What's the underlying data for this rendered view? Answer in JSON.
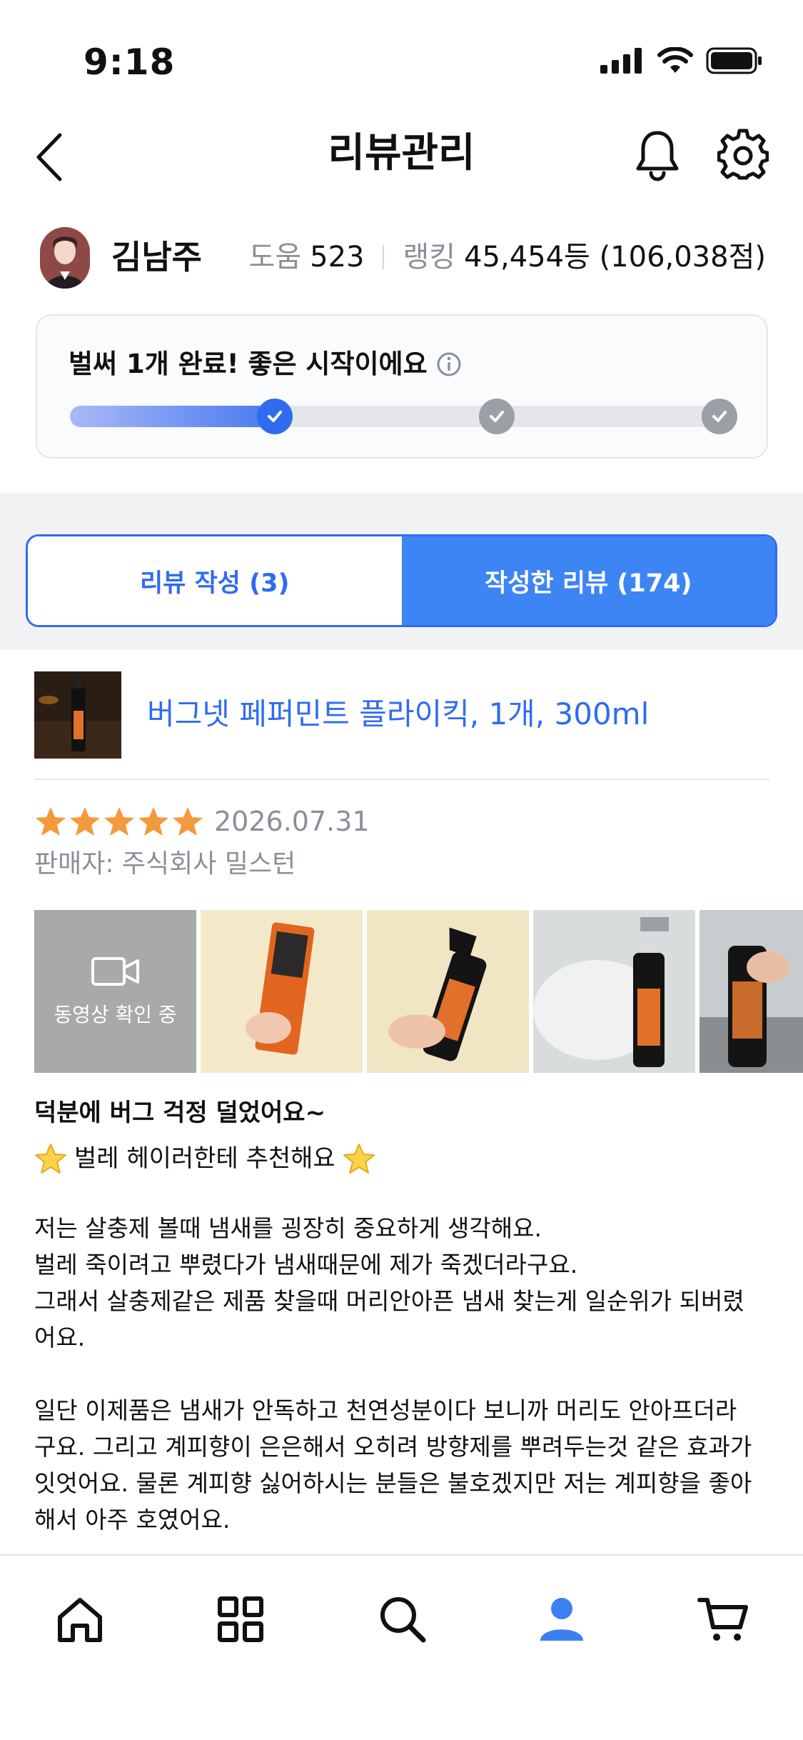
{
  "status_bar": {
    "time": "9:18"
  },
  "header": {
    "title": "리뷰관리"
  },
  "profile": {
    "name": "김남주",
    "help_label": "도움",
    "help_count": "523",
    "ranking_label": "랭킹",
    "ranking_value": "45,454등 (106,038점)"
  },
  "progress": {
    "message": "벌써 1개 완료! 좋은 시작이에요",
    "fraction": 0.3
  },
  "tabs": [
    {
      "label": "리뷰 작성 (3)",
      "active": false
    },
    {
      "label": "작성한 리뷰 (174)",
      "active": true
    }
  ],
  "review": {
    "product_name": "버그넷 페퍼민트 플라이킥, 1개, 300ml",
    "rating": 5,
    "date": "2026.07.31",
    "seller": "판매자: 주식회사 밀스턴",
    "video_label": "동영상 확인 중",
    "title": "덕분에 버그 걱정 덜었어요~",
    "subtitle": "벌레 헤이러한테 추천해요",
    "body": [
      [
        "저는 살충제 볼때 냄새를 굉장히 중요하게 생각해요.",
        "벌레 죽이려고 뿌렸다가 냄새때문에 제가 죽겠더라구요.",
        "그래서 살충제같은 제품 찾을때 머리안아픈 냄새 찾는게 일순위가 되버렸",
        "어요."
      ],
      [
        "일단 이제품은 냄새가 안독하고 천연성분이다 보니까 머리도 안아프더라",
        "구요. 그리고 계피향이 은은해서 오히려 방향제를 뿌려두는것 같은 효과가",
        "잇엇어요. 물론 계피향 싫어하시는 분들은 불호겠지만 저는 계피향을 좋아",
        "해서 아주 호였어요."
      ]
    ]
  },
  "colors": {
    "accent": "#2f6cf0",
    "star": "#f39a3c"
  },
  "nav_icons": [
    "home-icon",
    "grid-icon",
    "search-icon",
    "person-icon",
    "cart-icon"
  ]
}
